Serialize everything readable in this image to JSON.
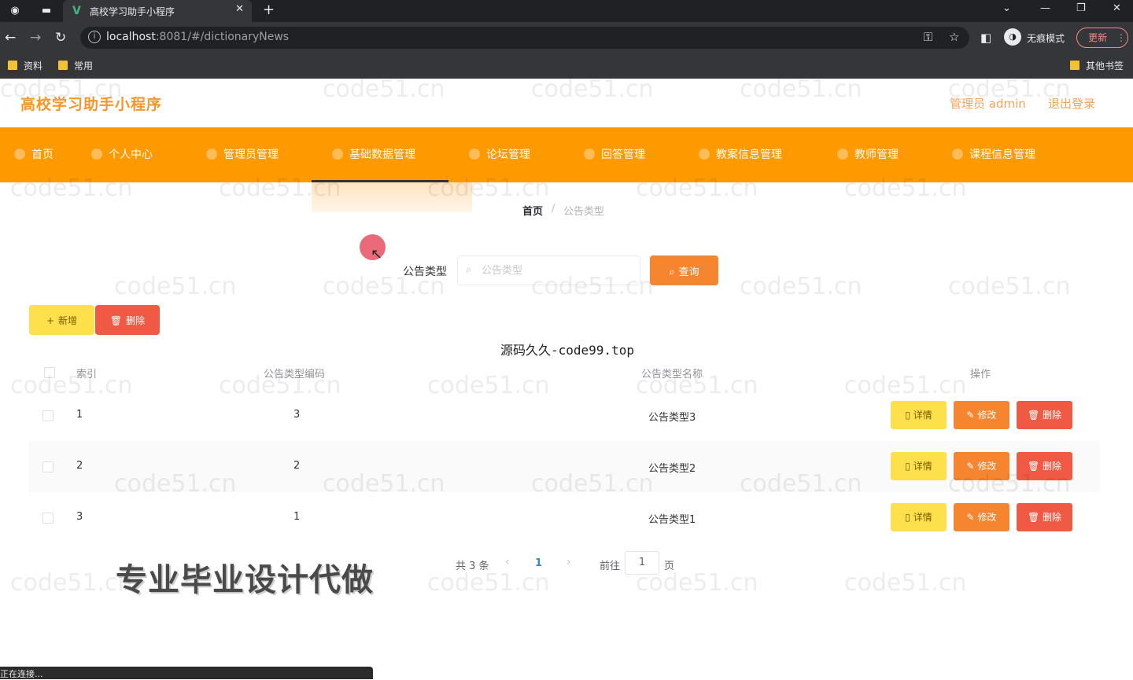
{
  "browser": {
    "tab_title": "高校学习助手小程序",
    "url_host": "localhost",
    "url_rest": ":8081/#/dictionaryNews",
    "incognito_label": "无痕模式",
    "update_label": "更新",
    "bookmarks": [
      "资料",
      "常用"
    ],
    "other_bookmarks": "其他书签",
    "status": "正在连接..."
  },
  "header": {
    "title": "高校学习助手小程序",
    "user": "管理员 admin",
    "logout": "退出登录"
  },
  "menu": {
    "items": [
      "首页",
      "个人中心",
      "管理员管理",
      "基础数据管理",
      "论坛管理",
      "回答管理",
      "教案信息管理",
      "教师管理",
      "课程信息管理"
    ],
    "active_index": 3
  },
  "breadcrumb": {
    "home": "首页",
    "separator": "/",
    "current": "公告类型"
  },
  "search": {
    "label": "公告类型",
    "placeholder": "公告类型",
    "query_button": "查询"
  },
  "actions": {
    "add": "新增",
    "delete": "删除"
  },
  "overlay_caption": "源码久久-code99.top",
  "table": {
    "headers": [
      "索引",
      "公告类型编码",
      "公告类型名称",
      "操作"
    ],
    "rows": [
      {
        "index": "1",
        "code": "3",
        "name": "公告类型3"
      },
      {
        "index": "2",
        "code": "2",
        "name": "公告类型2"
      },
      {
        "index": "3",
        "code": "1",
        "name": "公告类型1"
      }
    ],
    "row_actions": {
      "detail": "详情",
      "edit": "修改",
      "delete": "删除"
    }
  },
  "pagination": {
    "total": "共 3 条",
    "current_page": "1",
    "goto_label": "前往",
    "goto_value": "1",
    "unit": "页"
  },
  "promo_banner": "专业毕业设计代做",
  "watermark": "code51.cn",
  "colors": {
    "accent": "#ff9900",
    "query": "#f5862f",
    "add": "#fde04b",
    "delete": "#f05a44",
    "title": "#f5962d"
  }
}
